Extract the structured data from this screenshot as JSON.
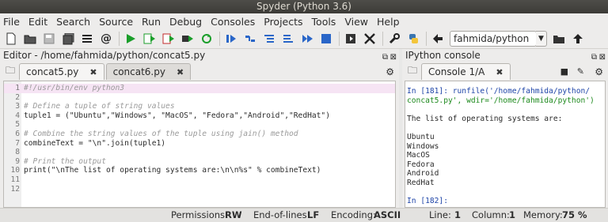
{
  "window": {
    "title": "Spyder (Python 3.6)"
  },
  "menu": [
    "File",
    "Edit",
    "Search",
    "Source",
    "Run",
    "Debug",
    "Consoles",
    "Projects",
    "Tools",
    "View",
    "Help"
  ],
  "toolbar": {
    "path": "fahmida/python"
  },
  "editor": {
    "title": "Editor - /home/fahmida/python/concat5.py",
    "tabs": [
      "concat5.py",
      "concat6.py"
    ],
    "lines": [
      {
        "n": "1",
        "text": "#!/usr/bin/env python3"
      },
      {
        "n": "2",
        "text": ""
      },
      {
        "n": "3",
        "text": "# Define a tuple of string values"
      },
      {
        "n": "4",
        "text": "tuple1 = (\"Ubuntu\",\"Windows\", \"MacOS\", \"Fedora\",\"Android\",\"RedHat\")"
      },
      {
        "n": "5",
        "text": ""
      },
      {
        "n": "6",
        "text": "# Combine the string values of the tuple using jain() method"
      },
      {
        "n": "7",
        "text": "combineText = \"\\n\".join(tuple1)"
      },
      {
        "n": "8",
        "text": ""
      },
      {
        "n": "9",
        "text": "# Print the output"
      },
      {
        "n": "10",
        "text": "print(\"\\nThe list of operating systems are:\\n\\n%s\" % combineText)"
      },
      {
        "n": "11",
        "text": ""
      },
      {
        "n": "12",
        "text": ""
      }
    ]
  },
  "console": {
    "title": "IPython console",
    "tab": "Console 1/A",
    "prompt_in": "In [181]: runfile('/home/fahmida/python/",
    "prompt_in2": "concat5.py', wdir='/home/fahmida/python')",
    "output_header": "The list of operating systems are:",
    "output": [
      "Ubuntu",
      "Windows",
      "MacOS",
      "Fedora",
      "Android",
      "RedHat"
    ],
    "prompt_next": "In [182]:"
  },
  "status": {
    "permissions_label": "Permissions:",
    "permissions_value": "RW",
    "eol_label": "End-of-lines:",
    "eol_value": "LF",
    "encoding_label": "Encoding:",
    "encoding_value": "ASCII",
    "line_label": "Line:",
    "line_value": "1",
    "column_label": "Column:",
    "column_value": "1",
    "memory_label": "Memory:",
    "memory_value": "75 %"
  }
}
